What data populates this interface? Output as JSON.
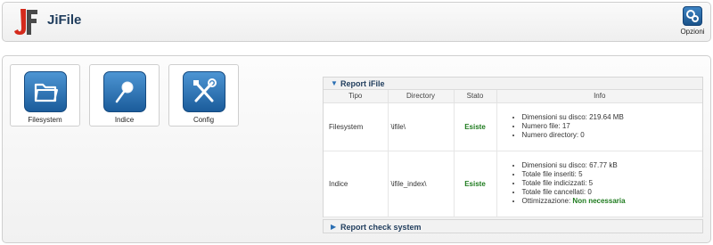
{
  "app": {
    "title": "JiFile",
    "logo_letters": "JF"
  },
  "toolbar": {
    "options_label": "Opzioni"
  },
  "colors": {
    "accent": "#2a6fb3",
    "title": "#1f3c5c",
    "ok": "#1e7b1e"
  },
  "quick_icons": [
    {
      "label": "Filesystem",
      "icon": "folder-icon"
    },
    {
      "label": "Indice",
      "icon": "magnifier-icon"
    },
    {
      "label": "Config",
      "icon": "tools-icon"
    }
  ],
  "report": {
    "title": "Report iFile",
    "columns": [
      "Tipo",
      "Directory",
      "Stato",
      "Info"
    ],
    "rows": [
      {
        "tipo": "Filesystem",
        "directory": "\\ifile\\",
        "stato": "Esiste",
        "info": [
          "Dimensioni su disco: 219.64 MB",
          "Numero file: 17",
          "Numero directory: 0"
        ]
      },
      {
        "tipo": "Indice",
        "directory": "\\ifile_index\\",
        "stato": "Esiste",
        "info": [
          "Dimensioni su disco: 67.77 kB",
          "Totale file inseriti: 5",
          "Totale file indicizzati: 5",
          "Totale file cancellati: 0"
        ],
        "optimization_label": "Ottimizzazione:",
        "optimization_value": "Non necessaria"
      }
    ]
  },
  "report_check": {
    "title": "Report check system"
  }
}
